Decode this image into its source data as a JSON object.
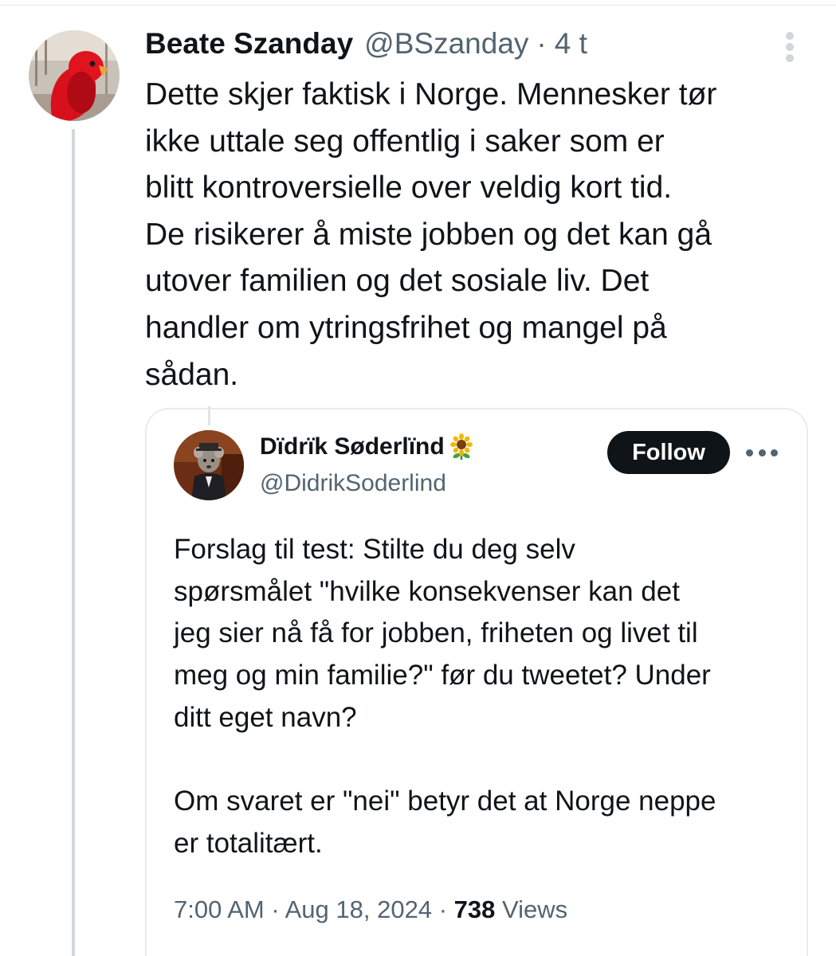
{
  "tweet": {
    "display_name": "Beate Szanday",
    "handle": "@BSzanday",
    "separator": "·",
    "time_ago": "4 t",
    "text": "Dette skjer faktisk i Norge. Mennesker tør\nikke uttale seg offentlig i saker som er\nblitt kontroversielle over veldig kort tid.\nDe risikerer å miste jobben og det kan gå\nutover familien og det sosiale liv. Det\nhandler om ytringsfrihet og mangel på\nsådan."
  },
  "quoted_tweet": {
    "display_name": "Dïdrïk Søderlïnd",
    "handle": "@DidrikSoderlind",
    "follow_label": "Follow",
    "text_paragraph_1": "Forslag til test: Stilte du deg selv\nspørsmålet \"hvilke konsekvenser kan det\njeg sier nå få for jobben, friheten og livet til\nmeg og min familie?\" før du tweetet? Under\nditt eget navn?",
    "text_paragraph_2": "Om svaret er \"nei\" betyr det at Norge neppe\ner totalitært.",
    "time": "7:00 AM",
    "separator": "·",
    "date": "Aug 18, 2024",
    "views_count": "738",
    "views_label": "Views"
  },
  "icons": {
    "name_emoji": "sunflower-icon",
    "menu": "more-vertical-icon",
    "quote_menu": "more-horizontal-icon"
  },
  "colors": {
    "text_primary": "#0f1419",
    "text_secondary": "#536471",
    "follow_button_bg": "#0f1419",
    "thread_line": "#cfd9de"
  }
}
